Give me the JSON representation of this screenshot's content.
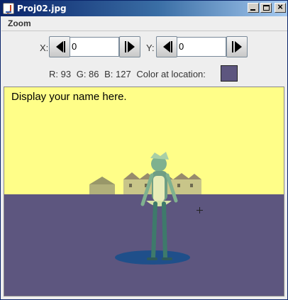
{
  "window": {
    "title": "Proj02.jpg",
    "icons": {
      "app": "java-cup-icon",
      "minimize": "minimize-icon",
      "maximize": "maximize-icon",
      "close": "close-icon"
    },
    "close_glyph": "×"
  },
  "menu": {
    "zoom_label": "Zoom"
  },
  "controls": {
    "x_label": "X:",
    "x_value": "0",
    "y_label": "Y:",
    "y_value": "0",
    "arrow_icons": {
      "prev": "arrow-left-icon",
      "next": "arrow-right-icon"
    }
  },
  "color_info": {
    "r_text": "R: 93",
    "g_text": "G: 86",
    "b_text": "B: 127",
    "label": "Color at location:",
    "swatch_color": "#5d567f"
  },
  "canvas": {
    "overlay_text": "Display your name here.",
    "colors": {
      "sky": "#fffe88",
      "ground": "#5d567f",
      "figure": "#7fb18f",
      "shadow": "#1f4f8a"
    }
  }
}
